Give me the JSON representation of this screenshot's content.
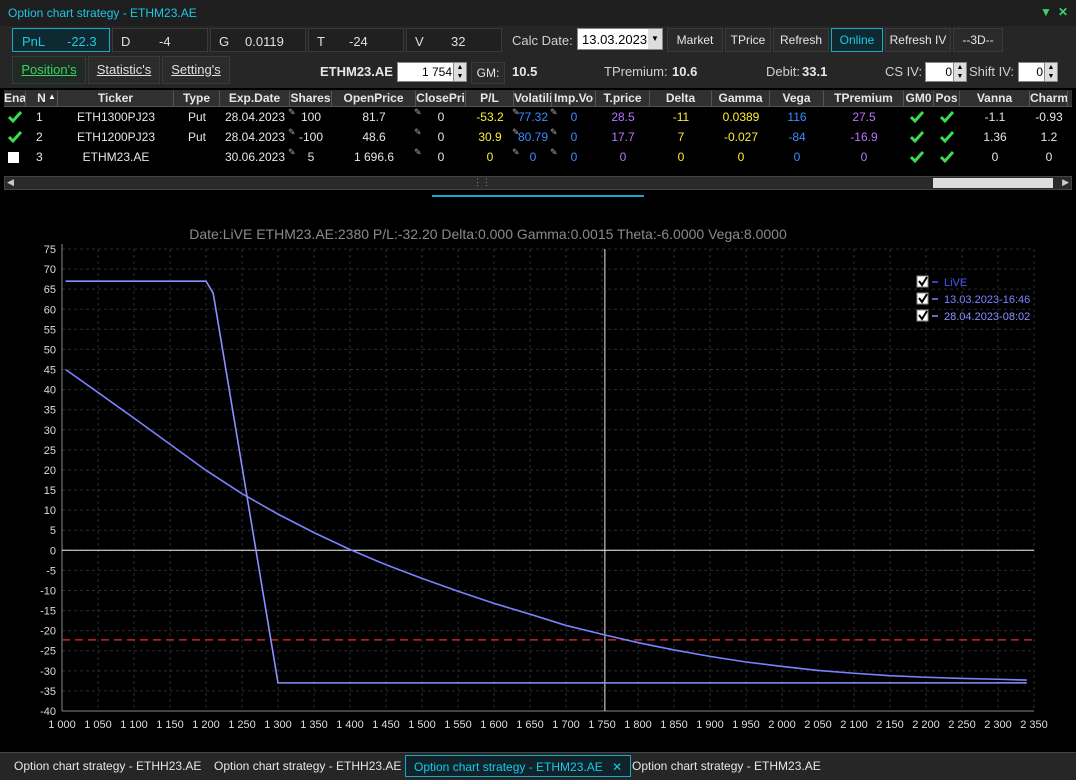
{
  "window": {
    "title": "Option chart strategy - ETHM23.AE"
  },
  "greeks": [
    {
      "label": "PnL",
      "value": "-22.3"
    },
    {
      "label": "D",
      "value": "-4"
    },
    {
      "label": "G",
      "value": "0.0119"
    },
    {
      "label": "T",
      "value": "-24"
    },
    {
      "label": "V",
      "value": "32"
    }
  ],
  "calc_date": {
    "label": "Calc Date:",
    "value": "13.03.2023"
  },
  "buttons": {
    "market": "Market",
    "tprice": "TPrice",
    "refresh": "Refresh",
    "online": "Online",
    "refresh_iv": "Refresh IV",
    "three_d": "--3D--"
  },
  "tabs": [
    "Position's",
    "Statistic's",
    "Setting's"
  ],
  "underlying": {
    "name": "ETHM23.AE",
    "price": "1 754",
    "gm_label": "GM:",
    "gm_value": "10.5"
  },
  "summary": {
    "tpremium_label": "TPremium:",
    "tpremium_value": "10.6",
    "debit_label": "Debit:",
    "debit_value": "33.1",
    "csiv_label": "CS IV:",
    "csiv_value": "0",
    "shiftiv_label": "Shift IV:",
    "shiftiv_value": "0"
  },
  "table": {
    "headers": [
      "Ena",
      "N",
      "Ticker",
      "Type",
      "Exp.Date",
      "Shares",
      "OpenPrice",
      "ClosePri",
      "P/L",
      "Volatili",
      "Imp.Vo",
      "T.price",
      "Delta",
      "Gamma",
      "Vega",
      "TPremium",
      "GM0",
      "Pos",
      "Vanna",
      "Charm"
    ],
    "rows": [
      {
        "n": "1",
        "ticker": "ETH1300PJ23",
        "type": "Put",
        "exp": "28.04.2023",
        "shares": "100",
        "open": "81.7",
        "close": "0",
        "pl": "-53.2",
        "vol": "77.32",
        "impvol": "0",
        "tprice": "28.5",
        "delta": "-11",
        "gamma": "0.0389",
        "vega": "116",
        "tpremium": "27.5",
        "vanna": "-1.1",
        "charm": "-0.93"
      },
      {
        "n": "2",
        "ticker": "ETH1200PJ23",
        "type": "Put",
        "exp": "28.04.2023",
        "shares": "-100",
        "open": "48.6",
        "close": "0",
        "pl": "30.9",
        "vol": "80.79",
        "impvol": "0",
        "tprice": "17.7",
        "delta": "7",
        "gamma": "-0.027",
        "vega": "-84",
        "tpremium": "-16.9",
        "vanna": "1.36",
        "charm": "1.2"
      },
      {
        "n": "3",
        "ticker": "ETHM23.AE",
        "type": "",
        "exp": "30.06.2023",
        "shares": "5",
        "open": "1 696.6",
        "close": "0",
        "pl": "0",
        "vol": "0",
        "impvol": "0",
        "tprice": "0",
        "delta": "0",
        "gamma": "0",
        "vega": "0",
        "tpremium": "0",
        "vanna": "0",
        "charm": "0"
      }
    ]
  },
  "chart_data": {
    "type": "line",
    "title": "Date:LiVE  ETHM23.AE:2380  P/L:-32.20  Delta:0.000  Gamma:0.0015  Theta:-6.0000  Vega:8.0000",
    "xlim": [
      1000,
      2350
    ],
    "ylim": [
      -40,
      75
    ],
    "x_ticks": [
      1000,
      1050,
      1100,
      1150,
      1200,
      1250,
      1300,
      1350,
      1400,
      1450,
      1500,
      1550,
      1600,
      1650,
      1700,
      1750,
      1800,
      1850,
      1900,
      1950,
      2000,
      2050,
      2100,
      2150,
      2200,
      2250,
      2300,
      2350
    ],
    "x_tick_labels": [
      "1 000",
      "1 050",
      "1 100",
      "1 150",
      "1 200",
      "1 250",
      "1 300",
      "1 350",
      "1 400",
      "1 450",
      "1 500",
      "1 550",
      "1 600",
      "1 650",
      "1 700",
      "1 750",
      "1 800",
      "1 850",
      "1 900",
      "1 950",
      "2 000",
      "2 050",
      "2 100",
      "2 150",
      "2 200",
      "2 250",
      "2 300",
      "2 350"
    ],
    "y_ticks": [
      -40,
      -35,
      -30,
      -25,
      -20,
      -15,
      -10,
      -5,
      0,
      5,
      10,
      15,
      20,
      25,
      30,
      35,
      40,
      45,
      50,
      55,
      60,
      65,
      70,
      75
    ],
    "grid": true,
    "legend_placement": "top-right",
    "crosshair_x": 1754,
    "crosshair_y": -22.3,
    "series": [
      {
        "name": "LiVE",
        "color": "#4a58ff",
        "x": [],
        "y": []
      },
      {
        "name": "13.03.2023-16:46",
        "color": "#7b82ff",
        "x": [
          1005,
          1050,
          1100,
          1150,
          1200,
          1250,
          1300,
          1350,
          1400,
          1450,
          1500,
          1550,
          1600,
          1650,
          1700,
          1750,
          1800,
          1850,
          1900,
          1950,
          2000,
          2050,
          2100,
          2150,
          2200,
          2250,
          2300,
          2340
        ],
        "y": [
          45,
          39.3,
          32.9,
          26.4,
          19.9,
          14.1,
          9.0,
          4.4,
          0.2,
          -3.6,
          -7.0,
          -10.2,
          -13.2,
          -15.9,
          -18.7,
          -20.9,
          -23.0,
          -24.8,
          -26.4,
          -27.8,
          -28.9,
          -29.9,
          -30.6,
          -31.2,
          -31.6,
          -31.9,
          -32.1,
          -32.3
        ]
      },
      {
        "name": "28.04.2023-08:02",
        "color": "#8a90ff",
        "x": [
          1005,
          1200,
          1210,
          1300,
          1350,
          2340
        ],
        "y": [
          67,
          67,
          64,
          -33,
          -33,
          -33
        ]
      }
    ]
  }
}
